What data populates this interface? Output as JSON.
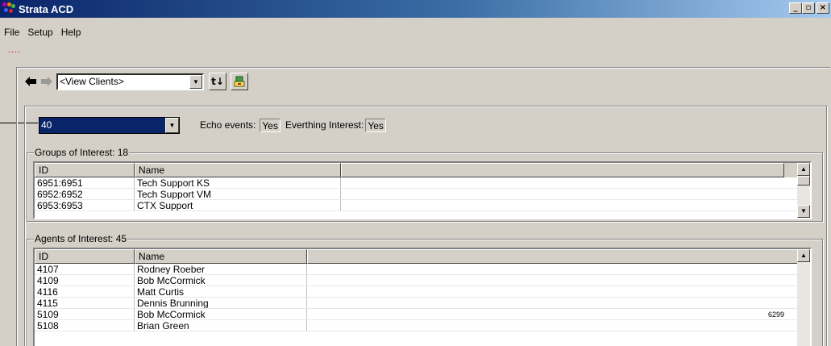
{
  "window": {
    "title": "Strata ACD",
    "minimize_glyph": "_",
    "maximize_glyph": "▫",
    "close_glyph": "×"
  },
  "menu": {
    "items": [
      "File",
      "Setup",
      "Help"
    ]
  },
  "status": {
    "dots": "....",
    "dots_color": "#e00000"
  },
  "toolbar": {
    "back_icon": "back-arrow-icon",
    "forward_icon": "forward-arrow-icon",
    "view_select": "<View Clients>",
    "refresh_glyph": "t↓",
    "clients_icon": "clients-icon"
  },
  "client": {
    "selected": "40",
    "echo_label": "Echo events:",
    "echo_value": "Yes",
    "interest_label": "Everthing Interest:",
    "interest_value": "Yes"
  },
  "groups": {
    "title": "Groups of Interest: 18",
    "columns": [
      "ID",
      "Name"
    ],
    "rows": [
      [
        "6951:6951",
        "Tech Support KS"
      ],
      [
        "6952:6952",
        "Tech Support VM"
      ],
      [
        "6953:6953",
        "CTX Support"
      ]
    ]
  },
  "agents": {
    "title": "Agents of Interest: 45",
    "columns": [
      "ID",
      "Name"
    ],
    "rows": [
      [
        "4107",
        "Rodney Roeber",
        ""
      ],
      [
        "4109",
        "Bob McCormick",
        ""
      ],
      [
        "4116",
        "Matt Curtis",
        ""
      ],
      [
        "4115",
        "Dennis Brunning",
        ""
      ],
      [
        "5109",
        "Bob McCormick",
        "6299"
      ],
      [
        "5108",
        "Brian Green",
        ""
      ]
    ]
  },
  "colors": {
    "title_bar": "#0a246a",
    "window_bg": "#d4d0c8",
    "selection": "#0a246a"
  }
}
